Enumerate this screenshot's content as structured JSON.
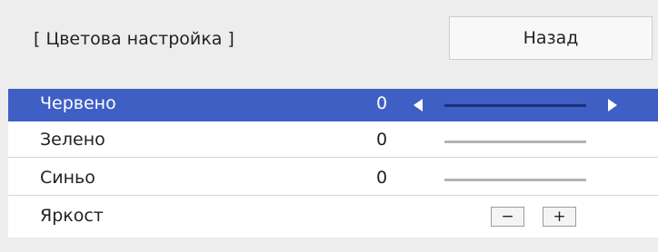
{
  "header": {
    "title": "[ Цветова настройка ]",
    "back_label": "Назад"
  },
  "rows": [
    {
      "label": "Червено",
      "value": "0",
      "selected": true
    },
    {
      "label": "Зелено",
      "value": "0",
      "selected": false
    },
    {
      "label": "Синьо",
      "value": "0",
      "selected": false
    },
    {
      "label": "Яркост",
      "minus": "−",
      "plus": "+"
    }
  ],
  "colors": {
    "selected_bg": "#3f5fc4",
    "selected_track": "#1c2f7a",
    "track": "#b4b4b4",
    "page_bg": "#ededed"
  },
  "icons": {
    "left": "triangle-left-icon",
    "right": "triangle-right-icon"
  }
}
